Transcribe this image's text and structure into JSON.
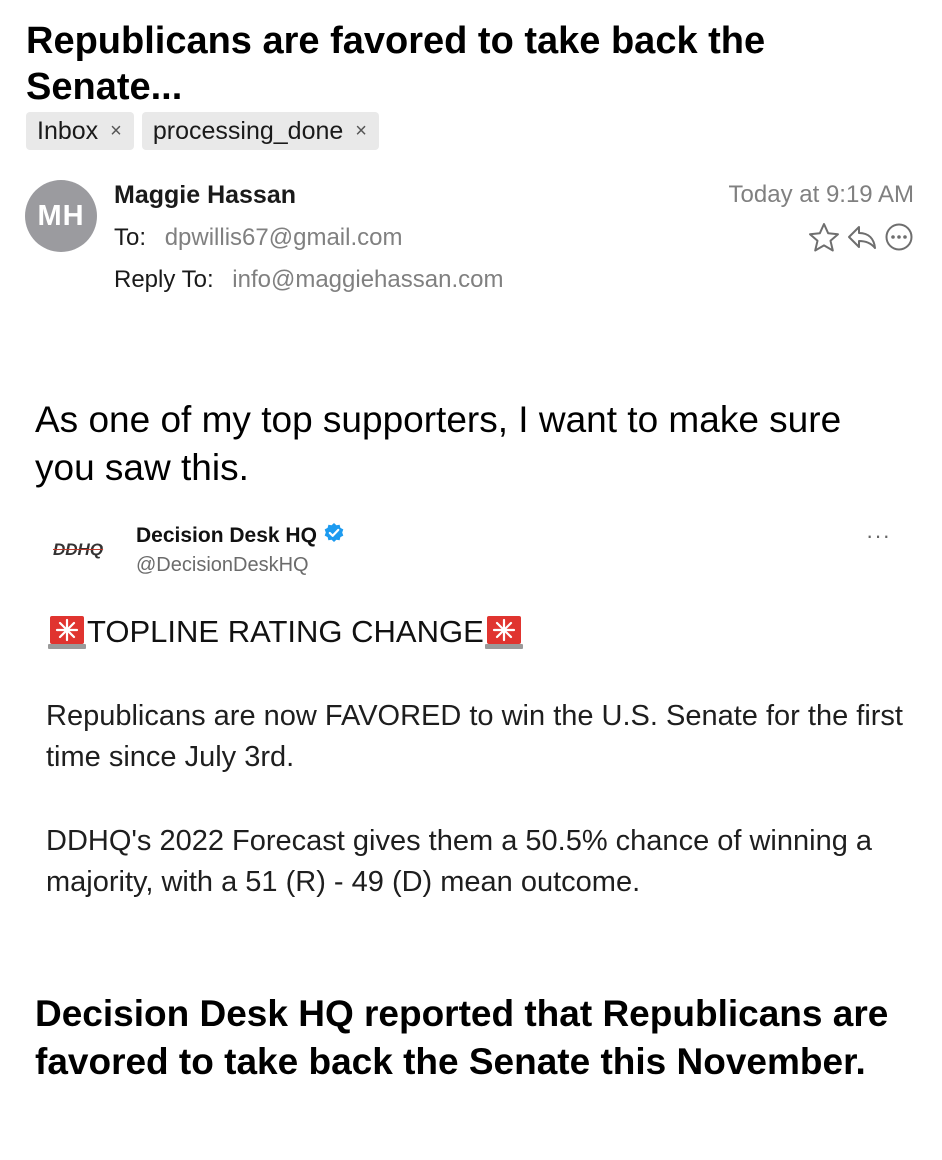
{
  "email": {
    "subject": "Republicans are favored to take back the Senate...",
    "tags": [
      {
        "label": "Inbox"
      },
      {
        "label": "processing_done"
      }
    ],
    "tag_remove_glyph": "×",
    "avatar_initials": "MH",
    "sender": "Maggie Hassan",
    "to_label": "To:",
    "to_value": "dpwillis67@gmail.com",
    "reply_to_label": "Reply To:",
    "reply_to_value": "info@maggiehassan.com",
    "date": "Today at 9:19 AM",
    "action_icons": [
      "star-icon",
      "reply-icon",
      "more-icon"
    ]
  },
  "body": {
    "intro": "As one of my top supporters, I want to make sure you saw this.",
    "tweet": {
      "logo_text": "DDHQ",
      "name": "Decision Desk HQ",
      "handle": "@DecisionDeskHQ",
      "more": "···",
      "headline": "TOPLINE RATING CHANGE",
      "paragraph1": "Republicans are now FAVORED to win the U.S. Senate for the first time since July 3rd.",
      "paragraph2": "DDHQ's 2022 Forecast gives them a 50.5% chance of winning a majority, with a 51 (R) - 49 (D) mean outcome.",
      "verified_color": "#1d9bf0",
      "siren_color": "#e0342f"
    },
    "outro": "Decision Desk HQ reported that Republicans are favored to take back the Senate this November."
  }
}
